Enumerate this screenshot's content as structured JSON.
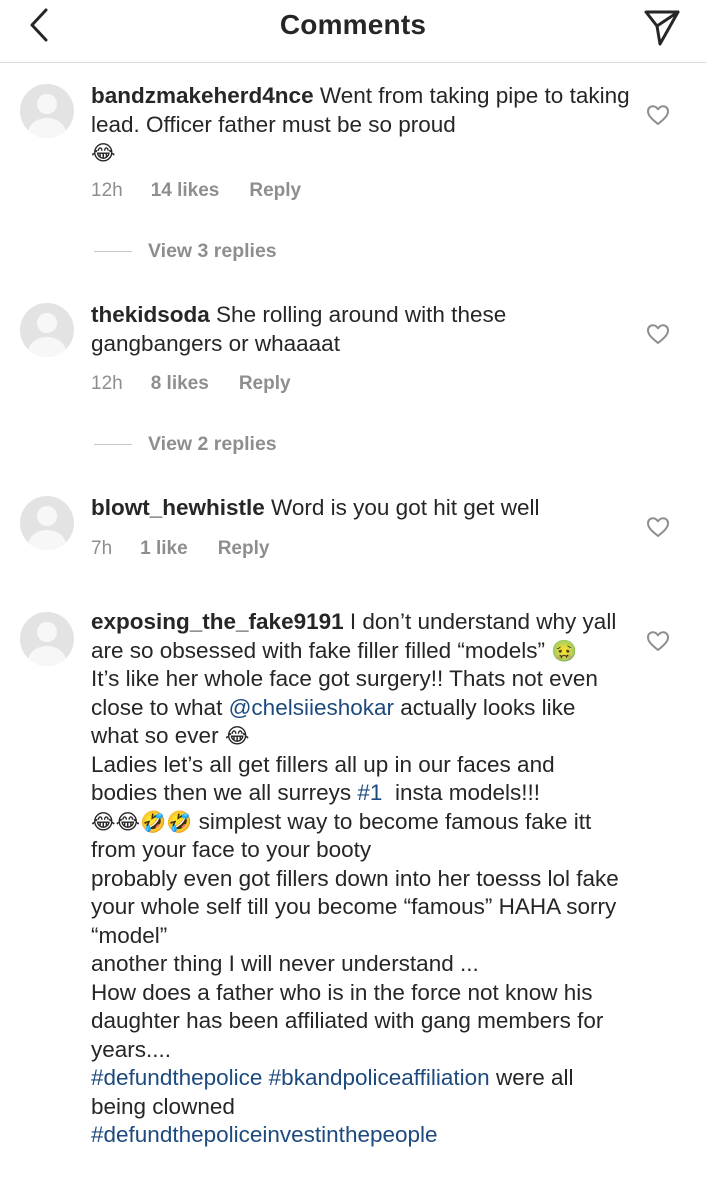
{
  "header": {
    "title": "Comments",
    "back_icon": "chevron-left-icon",
    "send_icon": "paper-plane-icon"
  },
  "comments": [
    {
      "username": "bandzmakeherd4nce",
      "text": "Went from taking pipe to taking lead. Officer father must be so proud",
      "emoji": "😂",
      "time": "12h",
      "likes": "14 likes",
      "reply": "Reply",
      "view_replies": "View 3 replies"
    },
    {
      "username": "thekidsoda",
      "text": "She rolling around with these gangbangers or whaaaat",
      "time": "12h",
      "likes": "8 likes",
      "reply": "Reply",
      "view_replies": "View 2 replies"
    },
    {
      "username": "blowt_hewhistle",
      "text": "Word is you got hit get well",
      "time": "7h",
      "likes": "1 like",
      "reply": "Reply"
    },
    {
      "username": "exposing_the_fake9191",
      "text_1": "I don’t understand why yall are so obsessed with fake filler filled “models”",
      "emoji_1": "🤢",
      "text_2": "It’s like her whole face got surgery!! Thats not even close to what",
      "mention": "@chelsiieshokar",
      "text_3": "actually looks like what so ever",
      "emoji_2": "😂",
      "text_4": "Ladies let’s all get fillers all up in our faces and bodies then we all surreys",
      "hashtag_1": "#1",
      "text_5": "insta models!!!",
      "emoji_3": "😂😂🤣🤣",
      "text_6": "simplest way to become famous fake itt from your face to your booty",
      "text_7": "probably even got fillers down into her toesss lol fake your whole self till you become “famous” HAHA sorry “model”",
      "text_8": "another thing I will never understand ...",
      "text_9": "How does a father who is in the force not know his daughter has been affiliated with gang members for years....",
      "hashtag_2": "#defundthepolice",
      "hashtag_3": "#bkandpoliceaffiliation",
      "text_10": "were all being clowned",
      "hashtag_4": "#defundthepoliceinvestinthepeople"
    }
  ],
  "icons": {
    "avatar": "default-avatar-icon",
    "like": "heart-outline-icon"
  }
}
